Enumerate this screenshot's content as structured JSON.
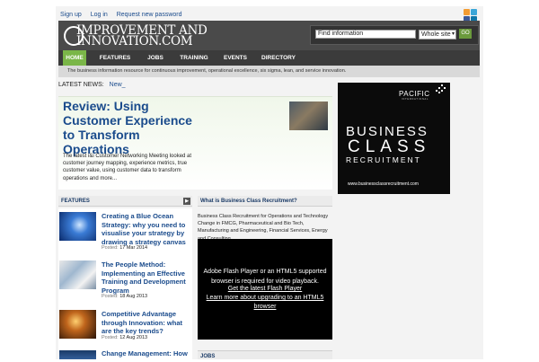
{
  "top_links": {
    "signup": "Sign up",
    "login": "Log in",
    "reset": "Request new password"
  },
  "social": {
    "icons": [
      "rss-icon",
      "twitter-icon",
      "facebook-icon",
      "linkedin-icon"
    ]
  },
  "logo": {
    "line1": "IMPROVEMENT AND",
    "line2": "INNOVATION.COM"
  },
  "search": {
    "placeholder": "Find information",
    "scope_value": "Whole site",
    "go_label": "GO"
  },
  "nav": {
    "items": [
      "HOME",
      "FEATURES",
      "JOBS",
      "TRAINING",
      "EVENTS",
      "DIRECTORY"
    ],
    "active": "HOME"
  },
  "tagline": "The business information resource for continuous improvement, operational excellence, six sigma, lean, and service innovation.",
  "latest_news": {
    "label": "LATEST NEWS:",
    "link": "New_"
  },
  "feature": {
    "title": "Review: Using Customer Experience to Transform Operations",
    "description": "The latest i&i Customer Networking Meeting looked at customer journey mapping, experience metrics, true customer value, using customer data to transform operations and more..."
  },
  "ad": {
    "brand": "PACIFIC",
    "brand_sub": "INTERNATIONAL",
    "line1": "BUSINESS",
    "line2": "CLASS",
    "line3": "RECRUITMENT",
    "url": "www.businessclassrecruitment.com"
  },
  "features": {
    "heading": "FEATURES",
    "posted_label": "Posted:",
    "articles": [
      {
        "title": "Creating a Blue Ocean Strategy: why you need to visualise your strategy by drawing a strategy canvas",
        "date": "17 Mar 2014"
      },
      {
        "title": "The People Method: Implementing an Effective Training and Development Program",
        "date": "18 Aug 2013"
      },
      {
        "title": "Competitive Advantage through Innovation: what are the key trends?",
        "date": "12 Aug 2013"
      },
      {
        "title": "Change Management: How",
        "date": ""
      }
    ]
  },
  "middle": {
    "heading": "What is Business Class Recruitment?",
    "body": "Business Class Recruitment for Operations and Technology Change in FMCG, Pharmaceutical and Bio Tech, Manufacturing and Engineering, Financial Services, Energy and Consulting.",
    "flash_line1": "Adobe Flash Player or an HTML5 supported browser is required for video playback.",
    "flash_link1": "Get the latest Flash Player",
    "flash_link2": "Learn more about upgrading to an HTML5 browser",
    "jobs_heading": "JOBS"
  },
  "colors": {
    "accent": "#7ab648",
    "link": "#1a4b8c",
    "header": "#4a4a4a",
    "nav": "#3b3b3b"
  }
}
